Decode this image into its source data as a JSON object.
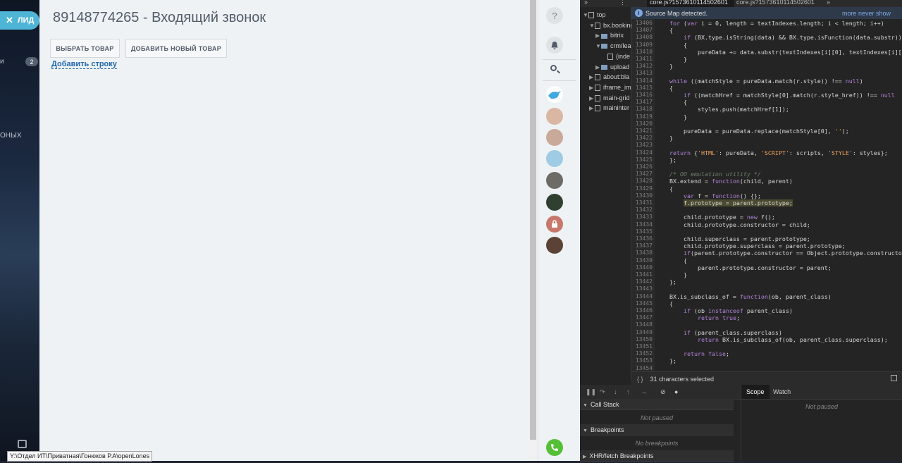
{
  "sidebar": {
    "lead_label": "ЛИД",
    "badge_count": "2",
    "fragment_1": "и",
    "fragment_2": "ОНЫХ"
  },
  "main": {
    "title": "89148774265 - Входящий звонок",
    "choose_button": "ВЫБРАТЬ ТОВАР",
    "add_new_button": "ДОБАВИТЬ НОВЫЙ ТОВАР",
    "add_row_link": "Добавить строку"
  },
  "devtools": {
    "tab_active": "core.js?1573610114502601",
    "tab_second": "core.js?1573610114502601",
    "tab_more": "»",
    "tree": [
      {
        "label": "top",
        "type": "page",
        "indent": 0
      },
      {
        "label": "bx.booking",
        "type": "cloud",
        "indent": 1
      },
      {
        "label": "bitrix",
        "type": "folder",
        "indent": 2
      },
      {
        "label": "crm/lea",
        "type": "folder",
        "indent": 2
      },
      {
        "label": "(inde",
        "type": "file",
        "indent": 3
      },
      {
        "label": "upload",
        "type": "folder",
        "indent": 2
      },
      {
        "label": "about:bla",
        "type": "page",
        "indent": 1
      },
      {
        "label": "iframe_im",
        "type": "page",
        "indent": 1
      },
      {
        "label": "main-grid",
        "type": "page",
        "indent": 1
      },
      {
        "label": "maininter",
        "type": "page",
        "indent": 1
      }
    ],
    "source_map_text": "Source Map detected.",
    "source_map_more": "more",
    "source_map_never": "never show",
    "line_start": 13406,
    "code_lines": [
      "for (var i = 0, length = textIndexes.length; i < length; i++)",
      "{",
      "    if (BX.type.isString(data) && BX.type.isFunction(data.substr))",
      "    {",
      "        pureData += data.substr(textIndexes[i][0], textIndexes[i][1]",
      "    }",
      "}",
      "",
      "while ((matchStyle = pureData.match(r.style)) !== null)",
      "{",
      "    if ((matchHref = matchStyle[0].match(r.style_href)) !== null",
      "    {",
      "        styles.push(matchHref[1]);",
      "    }",
      "",
      "    pureData = pureData.replace(matchStyle[0], '');",
      "}",
      "",
      "return {'HTML': pureData, 'SCRIPT': scripts, 'STYLE': styles};",
      "};",
      "",
      "/* OO emulation utility */",
      "BX.extend = function(child, parent)",
      "{",
      "    var f = function() {};",
      "    f.prototype = parent.prototype;",
      "",
      "    child.prototype = new f();",
      "    child.prototype.constructor = child;",
      "",
      "    child.superclass = parent.prototype;",
      "    child.prototype.superclass = parent.prototype;",
      "    if(parent.prototype.constructor == Object.prototype.constructor)",
      "    {",
      "        parent.prototype.constructor = parent;",
      "    }",
      "};",
      "",
      "BX.is_subclass_of = function(ob, parent_class)",
      "{",
      "    if (ob instanceof parent_class)",
      "        return true;",
      "",
      "    if (parent_class.superclass)",
      "        return BX.is_subclass_of(ob, parent_class.superclass);",
      "",
      "    return false;",
      "};",
      ""
    ],
    "highlight_line_index": 25,
    "status_text": "31 characters selected",
    "status_brace": "{ }",
    "call_stack_label": "Call Stack",
    "not_paused": "Not paused",
    "breakpoints_label": "Breakpoints",
    "no_breakpoints": "No breakpoints",
    "xhr_label": "XHR/fetch Breakpoints",
    "scope_tab": "Scope",
    "watch_tab": "Watch",
    "scope_not_paused": "Not paused"
  },
  "tooltip_path": "Y:\\Отдел ИТ\\Приватная\\Гонюков Р.А\\openLones"
}
